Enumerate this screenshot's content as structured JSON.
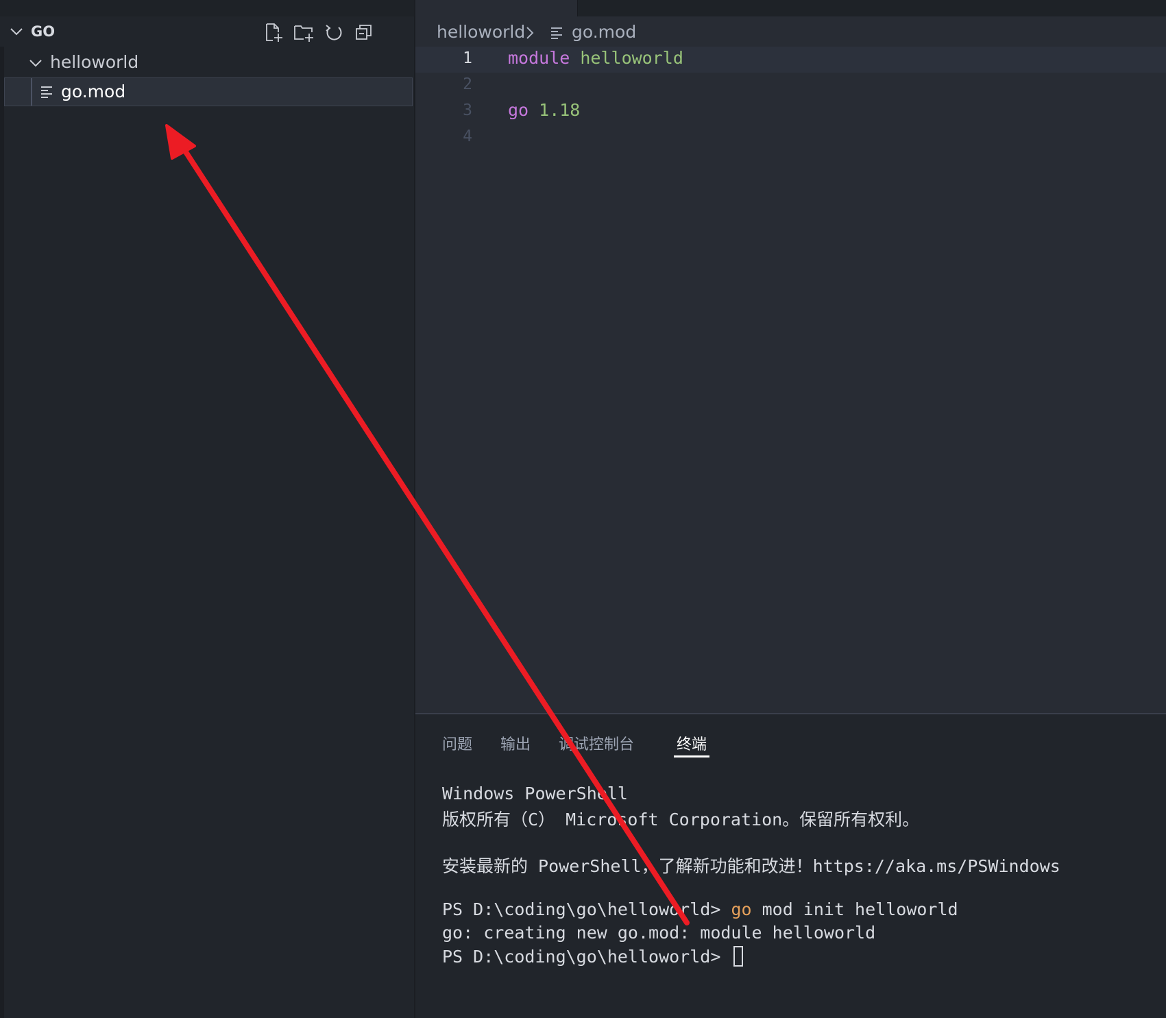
{
  "explorer": {
    "section_title": "GO",
    "toolbar_icons": [
      "new-file-icon",
      "new-folder-icon",
      "refresh-icon",
      "collapse-all-icon"
    ],
    "folder": "helloworld",
    "file": "go.mod"
  },
  "editor": {
    "breadcrumb": {
      "folder": "helloworld",
      "file": "go.mod"
    },
    "lines": [
      {
        "number": "1",
        "tokens": [
          {
            "text": "module ",
            "kind": "keyword"
          },
          {
            "text": "helloworld",
            "kind": "string"
          }
        ]
      },
      {
        "number": "2",
        "tokens": []
      },
      {
        "number": "3",
        "tokens": [
          {
            "text": "go ",
            "kind": "keyword"
          },
          {
            "text": "1.18",
            "kind": "string"
          }
        ]
      },
      {
        "number": "4",
        "tokens": []
      }
    ]
  },
  "panel": {
    "tabs": [
      {
        "label": "问题",
        "active": false
      },
      {
        "label": "输出",
        "active": false
      },
      {
        "label": "调试控制台",
        "active": false
      },
      {
        "label": "终端",
        "active": true
      }
    ],
    "terminal": {
      "line1": "Windows PowerShell",
      "line2": "版权所有（C） Microsoft Corporation。保留所有权利。",
      "line3": "安装最新的 PowerShell，了解新功能和改进！https://aka.ms/PSWindows",
      "prompt1": "PS D:\\coding\\go\\helloworld> ",
      "cmd_go": "go",
      "cmd_rest": " mod init helloworld",
      "output": "go: creating new go.mod: module helloworld",
      "prompt2": "PS D:\\coding\\go\\helloworld> "
    }
  },
  "colors": {
    "keyword": "#c678dd",
    "string": "#98c379",
    "annotation_arrow": "#ec1c24",
    "terminal_command": "#e5a05b"
  }
}
